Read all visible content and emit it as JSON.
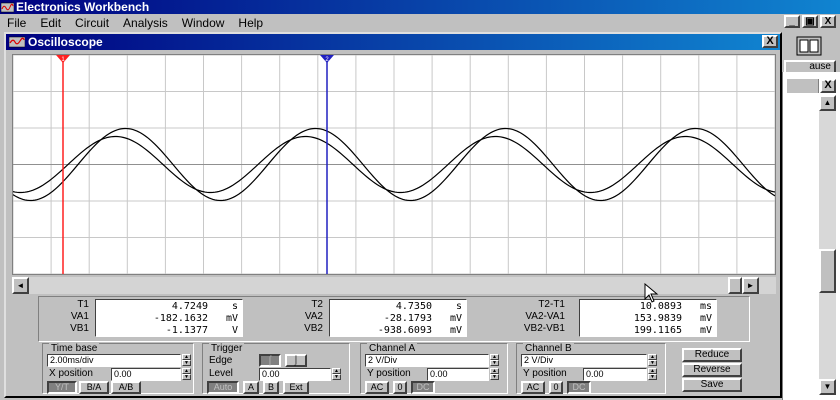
{
  "app": {
    "title": "Electronics Workbench",
    "caption_buttons": [
      "_",
      "□",
      "X"
    ]
  },
  "menu": [
    {
      "label": "File"
    },
    {
      "label": "Edit"
    },
    {
      "label": "Circuit"
    },
    {
      "label": "Analysis"
    },
    {
      "label": "Window"
    },
    {
      "label": "Help"
    }
  ],
  "mdi_buttons": [
    "_",
    "▣",
    "X"
  ],
  "background": {
    "pause_label": "ause",
    "close_glyph": "X"
  },
  "oscilloscope": {
    "title": "Oscilloscope",
    "close_glyph": "X",
    "cursor1_label": "1",
    "cursor2_label": "2",
    "colors": {
      "cursor1": "#ff2020",
      "cursor2": "#2020c0",
      "trace": "#000000",
      "grid": "#c8c8c8"
    },
    "readout": {
      "t1": {
        "label": "T1",
        "value": "4.7249",
        "unit": "s"
      },
      "va1": {
        "label": "VA1",
        "value": "-182.1632",
        "unit": "mV"
      },
      "vb1": {
        "label": "VB1",
        "value": "-1.1377",
        "unit": "V"
      },
      "t2": {
        "label": "T2",
        "value": "4.7350",
        "unit": "s"
      },
      "va2": {
        "label": "VA2",
        "value": "-28.1793",
        "unit": "mV"
      },
      "vb2": {
        "label": "VB2",
        "value": "-938.6093",
        "unit": "mV"
      },
      "dt": {
        "label": "T2-T1",
        "value": "10.0893",
        "unit": "ms"
      },
      "dva": {
        "label": "VA2-VA1",
        "value": "153.9839",
        "unit": "mV"
      },
      "dvb": {
        "label": "VB2-VB1",
        "value": "199.1165",
        "unit": "mV"
      }
    },
    "timebase": {
      "title": "Time base",
      "scale": "2.00ms/div",
      "xpos_label": "X position",
      "xpos": "0.00",
      "modes": [
        "Y/T",
        "B/A",
        "A/B"
      ]
    },
    "trigger": {
      "title": "Trigger",
      "edge_label": "Edge",
      "level_label": "Level",
      "level": "0.00",
      "sources": [
        "Auto",
        "A",
        "B",
        "Ext"
      ]
    },
    "channel_a": {
      "title": "Channel A",
      "scale": "2 V/Div",
      "ypos_label": "Y position",
      "ypos": "0.00",
      "coupling": [
        "AC",
        "0",
        "DC"
      ]
    },
    "channel_b": {
      "title": "Channel B",
      "scale": "2 V/Div",
      "ypos_label": "Y position",
      "ypos": "0.00",
      "coupling": [
        "AC",
        "0",
        "DC"
      ]
    },
    "actions": {
      "reduce": "Reduce",
      "reverse": "Reverse",
      "save": "Save"
    }
  }
}
